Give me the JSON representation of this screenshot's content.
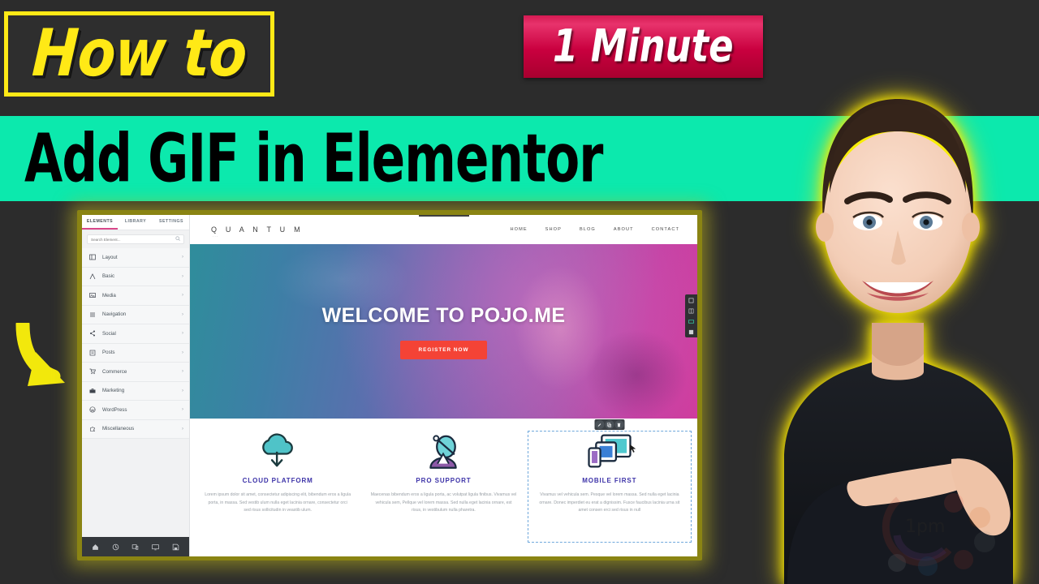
{
  "thumbnail": {
    "background_color": "#2c2c2c",
    "howto": {
      "text": "How to",
      "border_color": "#ffe916",
      "text_color": "#ffe916"
    },
    "badge": {
      "number": "1",
      "word": "Minute",
      "bg_color": "#c9003f",
      "text_color": "#ffffff"
    },
    "banner": {
      "title": "Add GIF in Elementor",
      "bg_color": "#0ce9ad",
      "text_color": "#000000"
    },
    "arrow": {
      "name": "curved-down-right-arrow",
      "color": "#f2e80c"
    }
  },
  "editor": {
    "panel": {
      "tabs": [
        {
          "label": "ELEMENTS",
          "active": true
        },
        {
          "label": "LIBRARY",
          "active": false
        },
        {
          "label": "SETTINGS",
          "active": false
        }
      ],
      "active_tab_underline_color": "#d9488a",
      "search": {
        "value": "",
        "placeholder": "Search Element...",
        "icon": "search-icon"
      },
      "categories": [
        {
          "label": "Layout",
          "icon": "layout-icon"
        },
        {
          "label": "Basic",
          "icon": "typography-a-icon"
        },
        {
          "label": "Media",
          "icon": "image-icon"
        },
        {
          "label": "Navigation",
          "icon": "menu-lines-icon"
        },
        {
          "label": "Social",
          "icon": "share-icon"
        },
        {
          "label": "Posts",
          "icon": "post-icon"
        },
        {
          "label": "Commerce",
          "icon": "cart-icon"
        },
        {
          "label": "Marketing",
          "icon": "briefcase-icon"
        },
        {
          "label": "WordPress",
          "icon": "wordpress-icon"
        },
        {
          "label": "Miscellaneous",
          "icon": "puzzle-icon"
        }
      ],
      "chevron": "›",
      "bottom_bar": [
        {
          "icon": "settings-home-icon"
        },
        {
          "icon": "history-icon"
        },
        {
          "icon": "responsive-icon"
        },
        {
          "icon": "preview-icon"
        },
        {
          "icon": "publish-save-icon"
        }
      ]
    },
    "site": {
      "logo": "Q U A N T U M",
      "logo_dots": "···",
      "nav": [
        "HOME",
        "SHOP",
        "BLOG",
        "ABOUT",
        "CONTACT"
      ],
      "hero": {
        "title": "WELCOME TO POJO.ME",
        "button_label": "REGISTER NOW",
        "button_color": "#f44336",
        "side_toolbar": [
          {
            "icon": "section-icon"
          },
          {
            "icon": "column-icon"
          },
          {
            "icon": "widget-icon"
          },
          {
            "icon": "grid-icon"
          }
        ]
      },
      "features": [
        {
          "title": "CLOUD PLATFORM",
          "icon": "cloud-download-icon",
          "body": "Lorem ipsum dolor sit amet, consectetur adipiscing elit, bibendum eros a ligula porta, in massa. Sed vestib ulum nulla eget lacinia ornare, consectetur orci sed risus sollicitudin in veastib ulum.",
          "selected": false
        },
        {
          "title": "PRO SUPPORT",
          "icon": "support-person-icon",
          "body": "Maecenas bibendum eros a ligula porta, ac volutpat ligula finibus. Vivamus vel vehicula sem, Pellque vel lorem massa. Sed nulla eget lacinia ornare, est risus, in vestibulum nulla pharetra.",
          "selected": false
        },
        {
          "title": "MOBILE FIRST",
          "icon": "devices-icon",
          "body": "Vivamus vel vehicula sem. Pesque vel lorem massa. Sed nulla eget lacinia ornare. Donec imperdiet eu erat a dignissim. Fusce faucibus lacinia urna sit amet consen erci sed risus in null",
          "selected": true,
          "toolbar": [
            {
              "icon": "edit-pencil-icon"
            },
            {
              "icon": "duplicate-icon"
            },
            {
              "icon": "delete-trash-icon"
            }
          ]
        }
      ]
    }
  }
}
